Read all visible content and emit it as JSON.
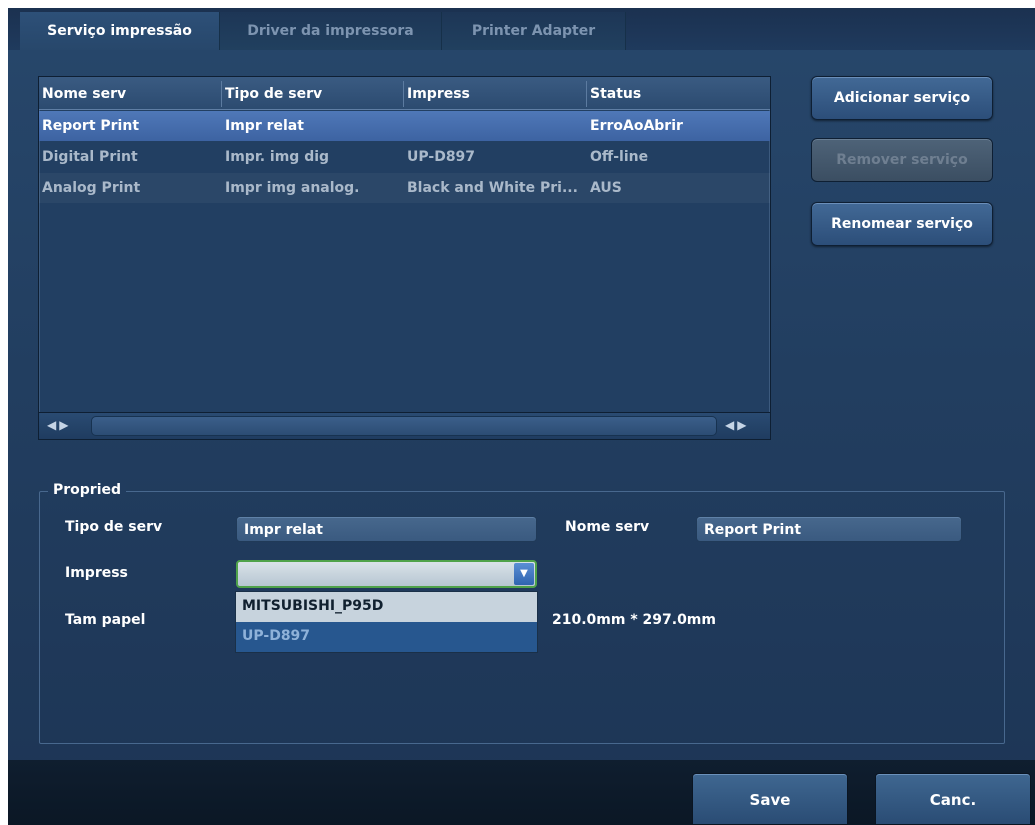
{
  "tabs": [
    {
      "label": "Serviço impressão",
      "active": true
    },
    {
      "label": "Driver da impressora",
      "active": false
    },
    {
      "label": "Printer Adapter",
      "active": false
    }
  ],
  "service_list": {
    "columns": [
      "Nome serv",
      "Tipo de serv",
      "Impress",
      "Status"
    ],
    "rows": [
      {
        "name": "Report Print",
        "type": "Impr relat",
        "printer": "",
        "status": "ErroAoAbrir",
        "selected": true
      },
      {
        "name": "Digital Print",
        "type": "Impr. img dig",
        "printer": "UP-D897",
        "status": "Off-line",
        "selected": false
      },
      {
        "name": "Analog Print",
        "type": "Impr img analog.",
        "printer": "Black and White Pri...",
        "status": "AUS",
        "selected": false
      }
    ]
  },
  "actions": {
    "add": "Adicionar serviço",
    "remove": "Remover serviço",
    "rename": "Renomear serviço"
  },
  "properties": {
    "title": "Propried",
    "service_type_label": "Tipo de serv",
    "service_type_value": "Impr relat",
    "service_name_label": "Nome serv",
    "service_name_value": "Report Print",
    "printer_label": "Impress",
    "printer_value": "",
    "printer_options": [
      "MITSUBISHI_P95D",
      "UP-D897"
    ],
    "highlighted_option": "UP-D897",
    "paper_label": "Tam papel",
    "paper_value": "210.0mm * 297.0mm"
  },
  "footer": {
    "save": "Save",
    "cancel": "Canc."
  },
  "colors": {
    "background": "#223e60",
    "selected_row": "#4670b0",
    "focus_border": "#4fa24a"
  }
}
